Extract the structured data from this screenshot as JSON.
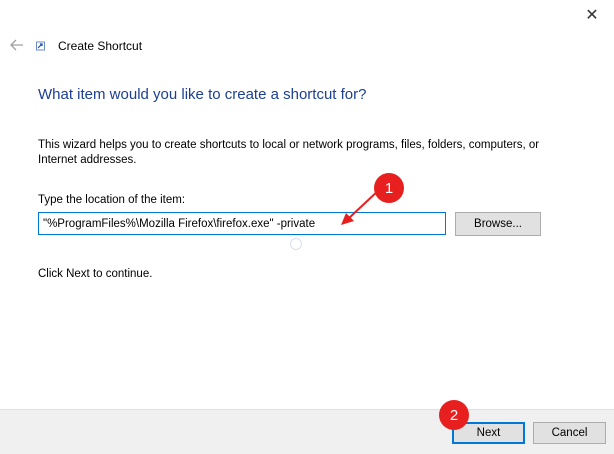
{
  "window": {
    "title": "Create Shortcut",
    "close_glyph": "✕",
    "back_icon": "back-arrow-icon",
    "app_icon": "shortcut-icon"
  },
  "main": {
    "heading": "What item would you like to create a shortcut for?",
    "description": "This wizard helps you to create shortcuts to local or network programs, files, folders, computers, or Internet addresses.",
    "location_label": "Type the location of the item:",
    "location_value": "\"%ProgramFiles%\\Mozilla Firefox\\firefox.exe\" -private",
    "browse_label": "Browse...",
    "continue_text": "Click Next to continue."
  },
  "footer": {
    "next_label": "Next",
    "cancel_label": "Cancel"
  },
  "annotations": {
    "step1": "1",
    "step2": "2",
    "color": "#e81f1f"
  }
}
